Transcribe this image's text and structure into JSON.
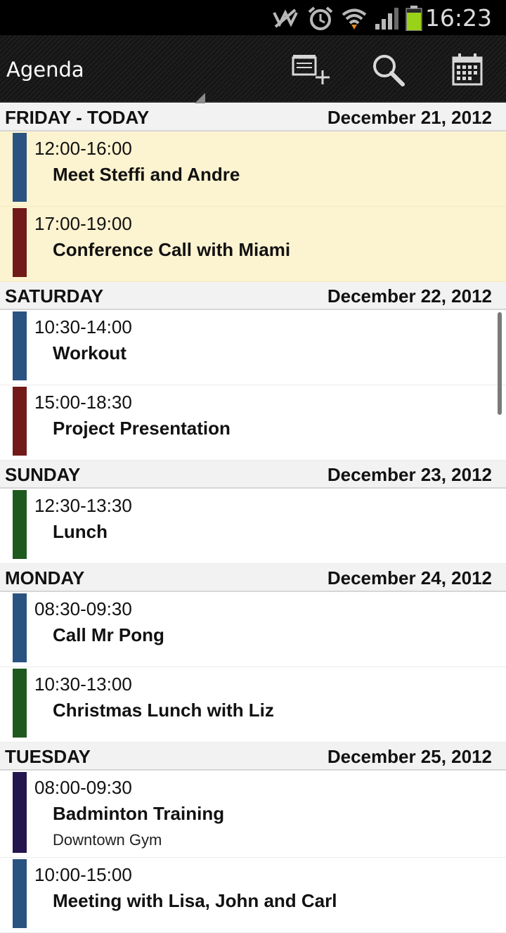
{
  "status_bar": {
    "time": "16:23",
    "icons": [
      "no-signal-icon",
      "alarm-icon",
      "wifi-icon",
      "signal-icon",
      "battery-icon"
    ],
    "battery_color": "#9ad21a"
  },
  "action_bar": {
    "title": "Agenda",
    "buttons": [
      "new-event-icon",
      "search-icon",
      "calendar-icon"
    ]
  },
  "colors": {
    "blue": "#2b5382",
    "red": "#721a1a",
    "green": "#1e5a1e",
    "purple": "#25154f",
    "today_bg": "#fcf3d0"
  },
  "days": [
    {
      "name": "FRIDAY - TODAY",
      "date": "December 21, 2012",
      "events": [
        {
          "time": "12:00-16:00",
          "title": "Meet Steffi and Andre",
          "color": "blue"
        },
        {
          "time": "17:00-19:00",
          "title": "Conference Call with Miami",
          "color": "red"
        }
      ]
    },
    {
      "name": "SATURDAY",
      "date": "December 22, 2012",
      "events": [
        {
          "time": "10:30-14:00",
          "title": "Workout",
          "color": "blue"
        },
        {
          "time": "15:00-18:30",
          "title": "Project Presentation",
          "color": "red"
        }
      ]
    },
    {
      "name": "SUNDAY",
      "date": "December 23, 2012",
      "events": [
        {
          "time": "12:30-13:30",
          "title": "Lunch",
          "color": "green"
        }
      ]
    },
    {
      "name": "MONDAY",
      "date": "December 24, 2012",
      "events": [
        {
          "time": "08:30-09:30",
          "title": "Call Mr Pong",
          "color": "blue"
        },
        {
          "time": "10:30-13:00",
          "title": "Christmas Lunch with Liz",
          "color": "green"
        }
      ]
    },
    {
      "name": "TUESDAY",
      "date": "December 25, 2012",
      "events": [
        {
          "time": "08:00-09:30",
          "title": "Badminton Training",
          "location": "Downtown Gym",
          "color": "purple"
        },
        {
          "time": "10:00-15:00",
          "title": "Meeting with Lisa, John and Carl",
          "color": "blue"
        }
      ]
    }
  ]
}
